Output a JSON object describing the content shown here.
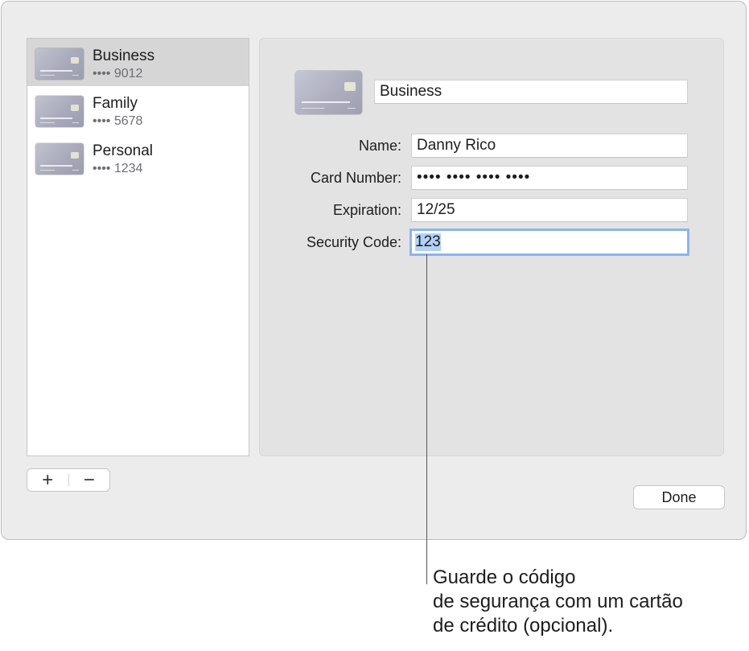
{
  "sidebar": {
    "items": [
      {
        "title": "Business",
        "subtitle": "•••• 9012",
        "selected": true
      },
      {
        "title": "Family",
        "subtitle": "•••• 5678",
        "selected": false
      },
      {
        "title": "Personal",
        "subtitle": "•••• 1234",
        "selected": false
      }
    ],
    "add_label": "+",
    "remove_label": "−"
  },
  "detail": {
    "card_description": "Business",
    "fields": {
      "name_label": "Name:",
      "name_value": "Danny Rico",
      "card_number_label": "Card Number:",
      "card_number_value": "•••• •••• •••• ••••",
      "expiration_label": "Expiration:",
      "expiration_value": "12/25",
      "security_code_label": "Security Code:",
      "security_code_value": "123"
    }
  },
  "footer": {
    "done_label": "Done"
  },
  "callout": {
    "line1": "Guarde o código",
    "line2": "de segurança com um cartão",
    "line3": "de crédito (opcional)."
  },
  "colors": {
    "focus_ring": "#8bb4f0",
    "selection": "#b3d1f5",
    "selected_row": "#d6d6d6"
  }
}
